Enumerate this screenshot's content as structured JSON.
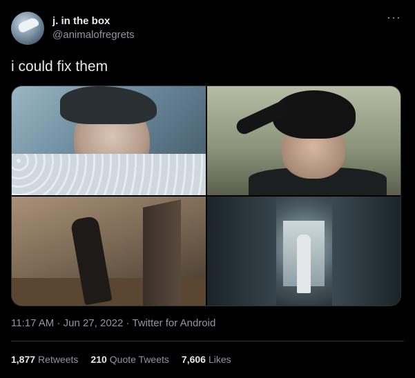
{
  "author": {
    "name": "j. in the box",
    "handle": "@animalofregrets"
  },
  "more_icon": "more-horizontal-icon",
  "tweet": {
    "text": "i could fix them"
  },
  "media": {
    "count": 4
  },
  "meta": {
    "time": "11:17 AM",
    "separator": " · ",
    "date": "Jun 27, 2022",
    "source": "Twitter for Android"
  },
  "stats": {
    "retweets_count": "1,877",
    "retweets_label": "Retweets",
    "quotes_count": "210",
    "quotes_label": "Quote Tweets",
    "likes_count": "7,606",
    "likes_label": "Likes"
  }
}
